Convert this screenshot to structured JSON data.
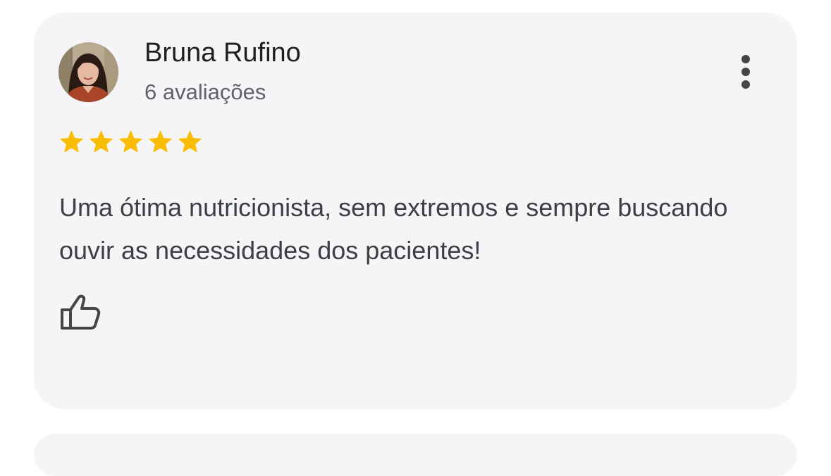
{
  "review": {
    "reviewer_name": "Bruna Rufino",
    "review_count": "6 avaliações",
    "rating": 5,
    "rating_max": 5,
    "star_color": "#fbbc04",
    "text": "Uma ótima nutricionista, sem extremos e sempre buscando ouvir as necessidades dos pacientes!",
    "icons": {
      "more": "more-vert-icon",
      "like": "thumbs-up-icon"
    }
  }
}
